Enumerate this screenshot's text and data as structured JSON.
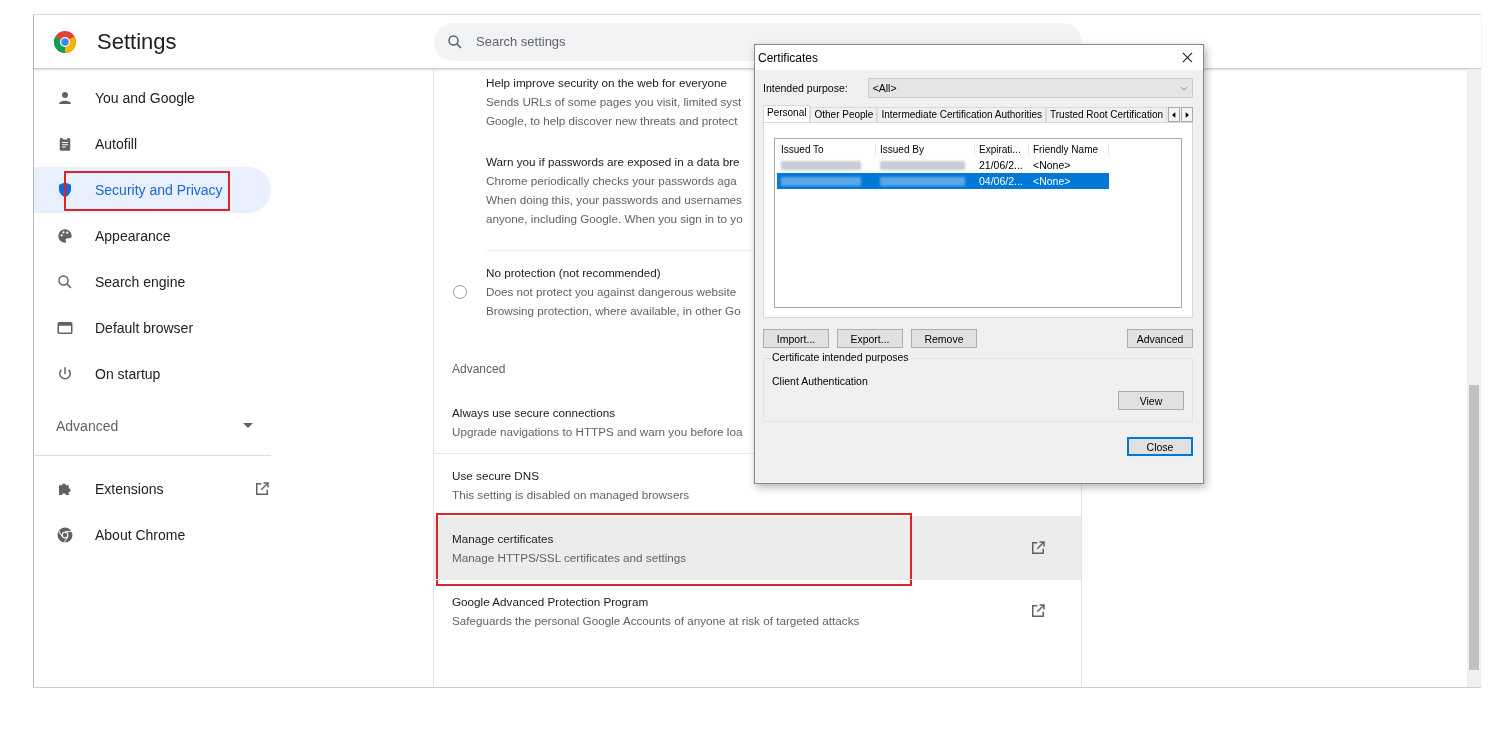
{
  "header": {
    "title": "Settings",
    "search_placeholder": "Search settings"
  },
  "sidebar": {
    "items": [
      {
        "label": "You and Google",
        "kind": "person",
        "selected": false,
        "annotated": false
      },
      {
        "label": "Autofill",
        "kind": "clipboard",
        "selected": false,
        "annotated": false
      },
      {
        "label": "Security and Privacy",
        "kind": "shield",
        "selected": true,
        "annotated": true
      },
      {
        "label": "Appearance",
        "kind": "palette",
        "selected": false,
        "annotated": false
      },
      {
        "label": "Search engine",
        "kind": "search",
        "selected": false,
        "annotated": false
      },
      {
        "label": "Default browser",
        "kind": "browser",
        "selected": false,
        "annotated": false
      },
      {
        "label": "On startup",
        "kind": "power",
        "selected": false,
        "annotated": false
      }
    ],
    "advanced": {
      "label": "Advanced",
      "expanded": false
    },
    "extra": [
      {
        "label": "Extensions",
        "kind": "puzzle",
        "external": true
      },
      {
        "label": "About Chrome",
        "kind": "chrome",
        "external": false
      }
    ]
  },
  "content": {
    "options": [
      {
        "kind": "sub",
        "title": "Help improve security on the web for everyone",
        "lines": [
          "Sends URLs of some pages you visit, limited syst",
          "Google, to help discover new threats and protect"
        ]
      },
      {
        "kind": "sub",
        "title": "Warn you if passwords are exposed in a data bre",
        "lines": [
          "Chrome periodically checks your passwords aga",
          "When doing this, your passwords and usernames",
          "anyone, including Google. When you sign in to yo"
        ]
      },
      {
        "kind": "radio",
        "selected": false,
        "title": "No protection (not recommended)",
        "lines": [
          "Does not protect you against dangerous website",
          "Browsing protection, where available, in other Go"
        ]
      }
    ],
    "advanced_heading": "Advanced",
    "rows": [
      {
        "title": "Always use secure connections",
        "subtitle": "Upgrade navigations to HTTPS and warn you before loa",
        "highlighted": false,
        "annotated": false
      },
      {
        "title": "Use secure DNS",
        "subtitle": "This setting is disabled on managed browsers",
        "highlighted": false,
        "annotated": false
      },
      {
        "title": "Manage certificates",
        "subtitle": "Manage HTTPS/SSL certificates and settings",
        "external": true,
        "highlighted": true,
        "annotated": true
      },
      {
        "title": "Google Advanced Protection Program",
        "subtitle": "Safeguards the personal Google Accounts of anyone at risk of targeted attacks",
        "external": true,
        "highlighted": false,
        "annotated": false
      }
    ]
  },
  "dialog": {
    "title": "Certificates",
    "purpose_label": "Intended purpose:",
    "purpose_value": "<All>",
    "tabs": [
      {
        "label": "Personal",
        "selected": true
      },
      {
        "label": "Other People",
        "selected": false
      },
      {
        "label": "Intermediate Certification Authorities",
        "selected": false
      },
      {
        "label": "Trusted Root Certification",
        "selected": false
      }
    ],
    "columns": [
      "Issued To",
      "Issued By",
      "Expirati...",
      "Friendly Name"
    ],
    "rows": [
      {
        "expiration": "21/06/2...",
        "friendly_name": "<None>",
        "selected": false
      },
      {
        "expiration": "04/06/2...",
        "friendly_name": "<None>",
        "selected": true
      }
    ],
    "buttons": [
      "Import...",
      "Export...",
      "Remove"
    ],
    "advanced_button": "Advanced",
    "group_title": "Certificate intended purposes",
    "purposes": "Client Authentication",
    "view_button": "View",
    "close_button": "Close"
  }
}
